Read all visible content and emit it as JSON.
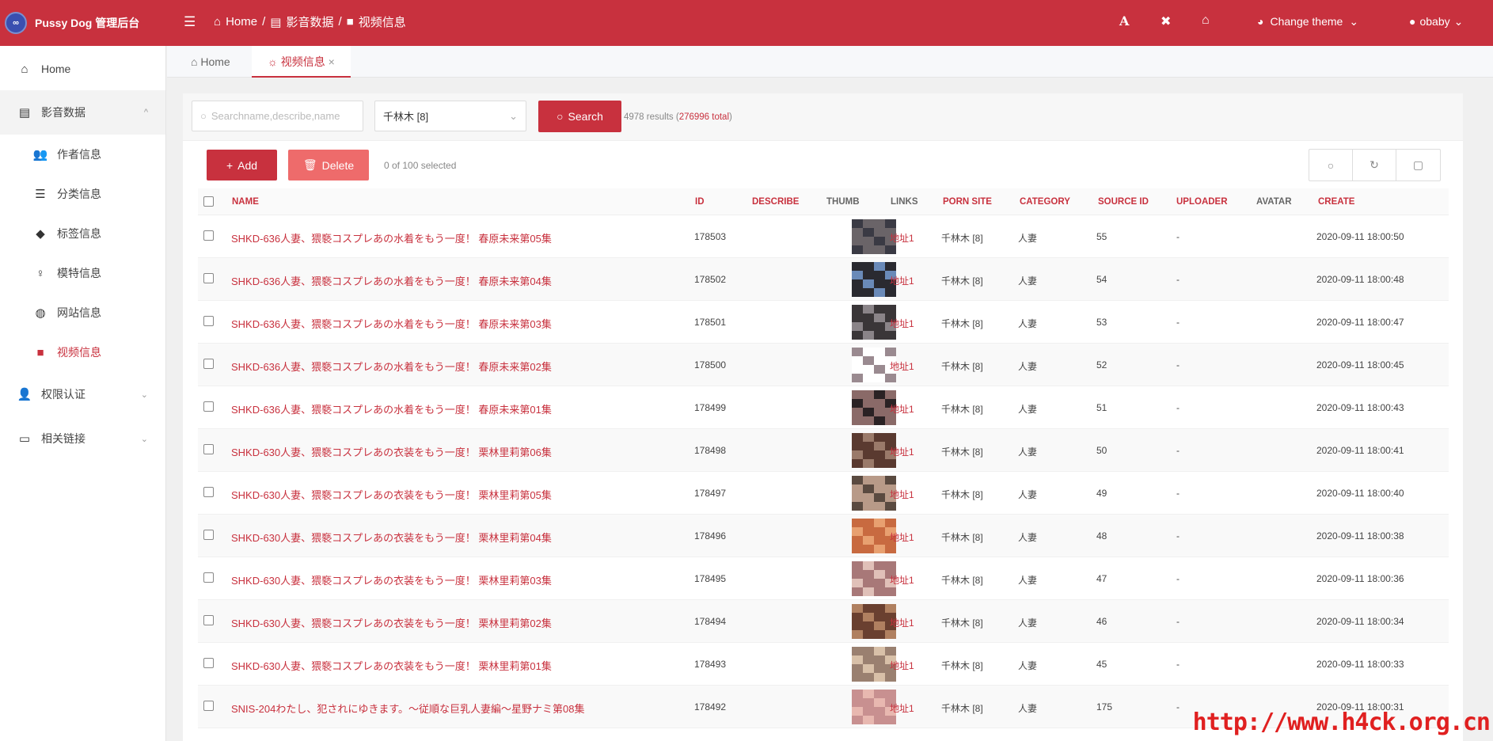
{
  "header": {
    "logo": "∞",
    "brand": "Pussy Dog 管理后台",
    "breadcrumb": [
      "Home",
      "影音数据",
      "视频信息"
    ],
    "theme": "Change theme",
    "user": "obaby",
    "font_icon": "A"
  },
  "sidebar": {
    "home": "Home",
    "group": "影音数据",
    "sub": [
      "作者信息",
      "分类信息",
      "标签信息",
      "模特信息",
      "网站信息",
      "视频信息"
    ],
    "auth": "权限认证",
    "links": "相关链接"
  },
  "tabs": {
    "home": "Home",
    "active": "视频信息"
  },
  "search": {
    "placeholder": "Searchname,describe,name",
    "select": "千林木 [8]",
    "button": "Search",
    "count": "4978 results (",
    "total": "276996 total",
    "close": ")"
  },
  "toolbar": {
    "add": "Add",
    "delete": "Delete",
    "selected": "0 of 100 selected"
  },
  "columns": [
    "NAME",
    "ID",
    "DESCRIBE",
    "THUMB",
    "LINKS",
    "PORN SITE",
    "CATEGORY",
    "SOURCE ID",
    "UPLOADER",
    "AVATAR",
    "CREATE"
  ],
  "rows": [
    {
      "name": "SHKD-636人妻、猥褻コスプレあの水着をもう一度！ 春原未来第05集",
      "id": "178503",
      "link": "地址1",
      "site": "千林木 [8]",
      "cat": "人妻",
      "src": "55",
      "up": "-",
      "create": "2020-09-11 18:00:50",
      "thumb": [
        "#6a6468",
        "#3a3a44"
      ]
    },
    {
      "name": "SHKD-636人妻、猥褻コスプレあの水着をもう一度！ 春原未来第04集",
      "id": "178502",
      "link": "地址1",
      "site": "千林木 [8]",
      "cat": "人妻",
      "src": "54",
      "up": "-",
      "create": "2020-09-11 18:00:48",
      "thumb": [
        "#2a2a30",
        "#6a8ab8"
      ]
    },
    {
      "name": "SHKD-636人妻、猥褻コスプレあの水着をもう一度！ 春原未来第03集",
      "id": "178501",
      "link": "地址1",
      "site": "千林木 [8]",
      "cat": "人妻",
      "src": "53",
      "up": "-",
      "create": "2020-09-11 18:00:47",
      "thumb": [
        "#3a3638",
        "#8a8488"
      ]
    },
    {
      "name": "SHKD-636人妻、猥褻コスプレあの水着をもう一度！ 春原未来第02集",
      "id": "178500",
      "link": "地址1",
      "site": "千林木 [8]",
      "cat": "人妻",
      "src": "52",
      "up": "-",
      "create": "2020-09-11 18:00:45",
      "thumb": [
        "#ffffff",
        "#9a8a90"
      ]
    },
    {
      "name": "SHKD-636人妻、猥褻コスプレあの水着をもう一度！ 春原未来第01集",
      "id": "178499",
      "link": "地址1",
      "site": "千林木 [8]",
      "cat": "人妻",
      "src": "51",
      "up": "-",
      "create": "2020-09-11 18:00:43",
      "thumb": [
        "#8a6a68",
        "#2a2224"
      ]
    },
    {
      "name": "SHKD-630人妻、猥褻コスプレあの衣装をもう一度！ 栗林里莉第06集",
      "id": "178498",
      "link": "地址1",
      "site": "千林木 [8]",
      "cat": "人妻",
      "src": "50",
      "up": "-",
      "create": "2020-09-11 18:00:41",
      "thumb": [
        "#5a3a30",
        "#9a7a6a"
      ]
    },
    {
      "name": "SHKD-630人妻、猥褻コスプレあの衣装をもう一度！ 栗林里莉第05集",
      "id": "178497",
      "link": "地址1",
      "site": "千林木 [8]",
      "cat": "人妻",
      "src": "49",
      "up": "-",
      "create": "2020-09-11 18:00:40",
      "thumb": [
        "#b89a88",
        "#5a4a40"
      ]
    },
    {
      "name": "SHKD-630人妻、猥褻コスプレあの衣装をもう一度！ 栗林里莉第04集",
      "id": "178496",
      "link": "地址1",
      "site": "千林木 [8]",
      "cat": "人妻",
      "src": "48",
      "up": "-",
      "create": "2020-09-11 18:00:38",
      "thumb": [
        "#c86a40",
        "#e8a070"
      ]
    },
    {
      "name": "SHKD-630人妻、猥褻コスプレあの衣装をもう一度！ 栗林里莉第03集",
      "id": "178495",
      "link": "地址1",
      "site": "千林木 [8]",
      "cat": "人妻",
      "src": "47",
      "up": "-",
      "create": "2020-09-11 18:00:36",
      "thumb": [
        "#a87878",
        "#e0c0b8"
      ]
    },
    {
      "name": "SHKD-630人妻、猥褻コスプレあの衣装をもう一度！ 栗林里莉第02集",
      "id": "178494",
      "link": "地址1",
      "site": "千林木 [8]",
      "cat": "人妻",
      "src": "46",
      "up": "-",
      "create": "2020-09-11 18:00:34",
      "thumb": [
        "#6a4030",
        "#b08060"
      ]
    },
    {
      "name": "SHKD-630人妻、猥褻コスプレあの衣装をもう一度！ 栗林里莉第01集",
      "id": "178493",
      "link": "地址1",
      "site": "千林木 [8]",
      "cat": "人妻",
      "src": "45",
      "up": "-",
      "create": "2020-09-11 18:00:33",
      "thumb": [
        "#9a8070",
        "#d8c0a8"
      ]
    },
    {
      "name": "SNIS-204わたし、犯されにゆきます。～従順な巨乳人妻編～星野ナミ第08集",
      "id": "178492",
      "link": "地址1",
      "site": "千林木 [8]",
      "cat": "人妻",
      "src": "175",
      "up": "-",
      "create": "2020-09-11 18:00:31",
      "thumb": [
        "#c89090",
        "#e8b8b0"
      ]
    }
  ],
  "watermark": "http://www.h4ck.org.cn",
  "colors": {
    "accent": "#c8313e",
    "delete": "#ee6b6b"
  }
}
